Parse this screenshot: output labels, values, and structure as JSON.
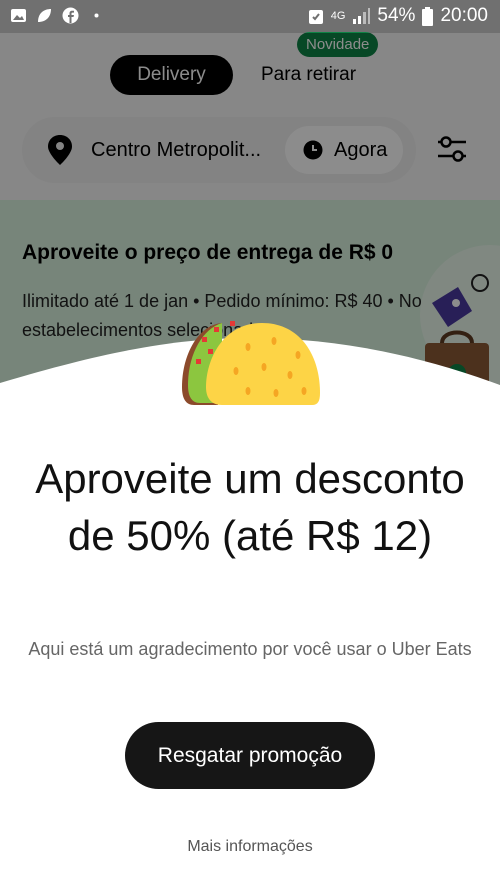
{
  "status_bar": {
    "battery": "54%",
    "time": "20:00",
    "network": "4G",
    "icons": [
      "image-icon",
      "leaf-icon",
      "facebook-icon",
      "dot-icon",
      "alarm-icon",
      "signal-icon",
      "battery-icon"
    ]
  },
  "header": {
    "tabs": [
      {
        "label": "Delivery",
        "active": true
      },
      {
        "label": "Para retirar",
        "active": false
      }
    ],
    "new_badge": "Novidade"
  },
  "location_bar": {
    "address": "Centro Metropolit...",
    "time_label": "Agora"
  },
  "promo_banner": {
    "title": "Aproveite o preço de entrega de R$ 0",
    "description": "Ilimitado até 1 de jan • Pedido mínimo: R$ 40 • Nos estabelecimentos selecionados"
  },
  "sheet": {
    "headline": "Aproveite um desconto de 50% (até R$ 12)",
    "subtitle": "Aqui está um agradecimento por você usar o Uber Eats",
    "cta_label": "Resgatar promoção",
    "more_info": "Mais informações"
  },
  "colors": {
    "status_bar": "#707070",
    "badge_green": "#0e8345",
    "banner_bg": "#d9f3df",
    "button_dark": "#161616"
  }
}
